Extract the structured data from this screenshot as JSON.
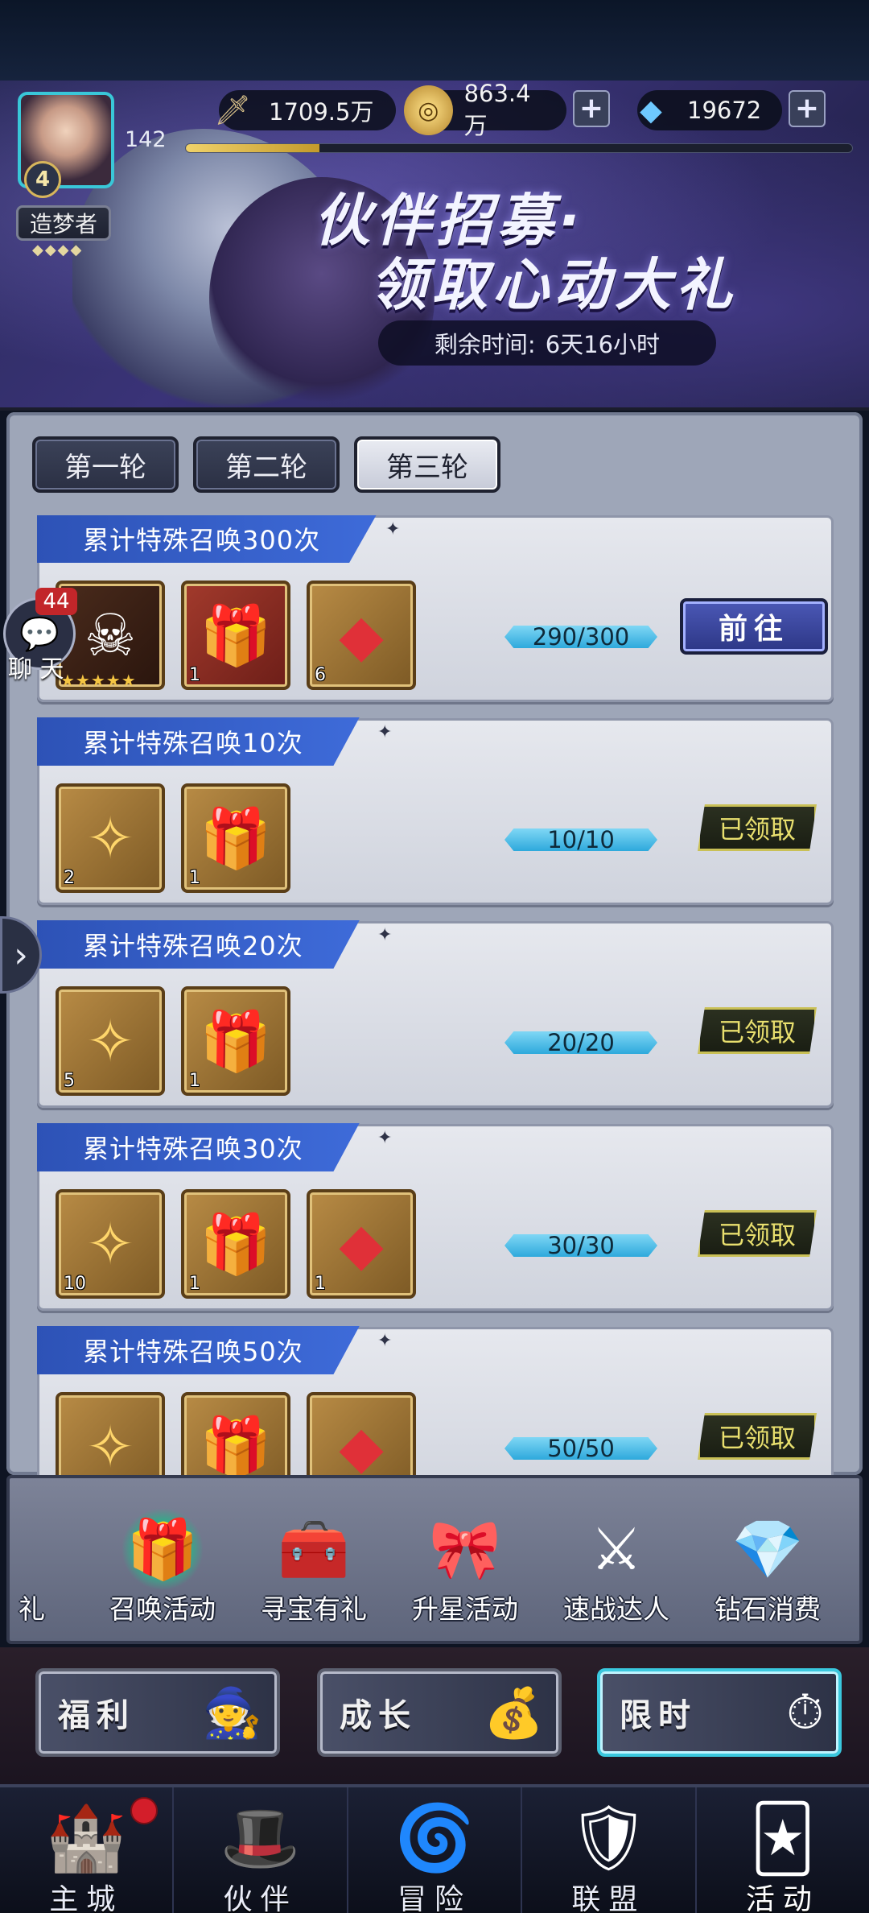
{
  "hud": {
    "level": "4",
    "power_number": "142",
    "title_badge": "造梦者",
    "stars": "◆◆◆◆",
    "xp_progress": 0.2,
    "resources": [
      {
        "name": "power",
        "icon": "sword-icon",
        "value": "1709.5万"
      },
      {
        "name": "gold",
        "icon": "coin-icon",
        "value": "863.4万"
      },
      {
        "name": "diamond",
        "icon": "diamond-icon",
        "value": "19672"
      }
    ]
  },
  "banner": {
    "title": "伙伴招募·",
    "subtitle": "领取心动大礼",
    "timer_label": "剩余时间:",
    "timer_value": "6天16小时",
    "help": "?"
  },
  "rounds": [
    {
      "label": "第一轮",
      "active": false
    },
    {
      "label": "第二轮",
      "active": false
    },
    {
      "label": "第三轮",
      "active": true
    }
  ],
  "tasks": [
    {
      "title": "累计特殊召唤300次",
      "progress": "290/300",
      "action": "前往",
      "claimed": false,
      "rewards": [
        {
          "type": "hero",
          "icon": "hero-card-icon",
          "qty": "",
          "stars": "★★★★★"
        },
        {
          "type": "giftbox",
          "icon": "gift-box-icon",
          "qty": "1"
        },
        {
          "type": "gem",
          "icon": "red-crystal-icon",
          "qty": "6"
        }
      ]
    },
    {
      "title": "累计特殊召唤10次",
      "progress": "10/10",
      "action": "已领取",
      "claimed": true,
      "rewards": [
        {
          "type": "scroll",
          "icon": "summon-scroll-icon",
          "qty": "2"
        },
        {
          "type": "giftbox",
          "icon": "gift-box-icon",
          "qty": "1"
        }
      ]
    },
    {
      "title": "累计特殊召唤20次",
      "progress": "20/20",
      "action": "已领取",
      "claimed": true,
      "rewards": [
        {
          "type": "scroll",
          "icon": "summon-scroll-icon",
          "qty": "5"
        },
        {
          "type": "giftbox",
          "icon": "gift-box-icon",
          "qty": "1"
        }
      ]
    },
    {
      "title": "累计特殊召唤30次",
      "progress": "30/30",
      "action": "已领取",
      "claimed": true,
      "rewards": [
        {
          "type": "scroll",
          "icon": "summon-scroll-icon",
          "qty": "10"
        },
        {
          "type": "giftbox",
          "icon": "gift-box-icon",
          "qty": "1"
        },
        {
          "type": "gem",
          "icon": "red-crystal-icon",
          "qty": "1"
        }
      ]
    },
    {
      "title": "累计特殊召唤50次",
      "progress": "50/50",
      "action": "已领取",
      "claimed": true,
      "rewards": [
        {
          "type": "scroll",
          "icon": "summon-scroll-icon",
          "qty": ""
        },
        {
          "type": "giftbox",
          "icon": "gift-box-icon",
          "qty": ""
        },
        {
          "type": "gem",
          "icon": "red-crystal-icon",
          "qty": ""
        }
      ]
    }
  ],
  "chat": {
    "count": "44",
    "label": "聊 天"
  },
  "activity_tabs": [
    {
      "label": "礼",
      "icon": "partial-icon",
      "active": false
    },
    {
      "label": "召唤活动",
      "icon": "gift-icon",
      "active": true
    },
    {
      "label": "寻宝有礼",
      "icon": "treasure-chest-icon",
      "active": false
    },
    {
      "label": "升星活动",
      "icon": "star-gift-icon",
      "active": false
    },
    {
      "label": "速战达人",
      "icon": "sword-shield-icon",
      "active": false
    },
    {
      "label": "钻石消费",
      "icon": "diamond-chest-icon",
      "active": false
    }
  ],
  "feature_buttons": [
    {
      "label": "福利",
      "icon": "character-icon",
      "active": false
    },
    {
      "label": "成长",
      "icon": "chest-coins-icon",
      "active": false
    },
    {
      "label": "限时",
      "icon": "pocket-watch-icon",
      "active": true
    }
  ],
  "bottom_nav": [
    {
      "label": "主城",
      "icon": "castle-icon",
      "active": false,
      "badge": true
    },
    {
      "label": "伙伴",
      "icon": "wizard-hat-icon",
      "active": false,
      "badge": false
    },
    {
      "label": "冒险",
      "icon": "portal-icon",
      "active": false,
      "badge": false
    },
    {
      "label": "联盟",
      "icon": "shield-icon",
      "active": false,
      "badge": false
    },
    {
      "label": "活动",
      "icon": "cards-icon",
      "active": true,
      "badge": false
    }
  ]
}
